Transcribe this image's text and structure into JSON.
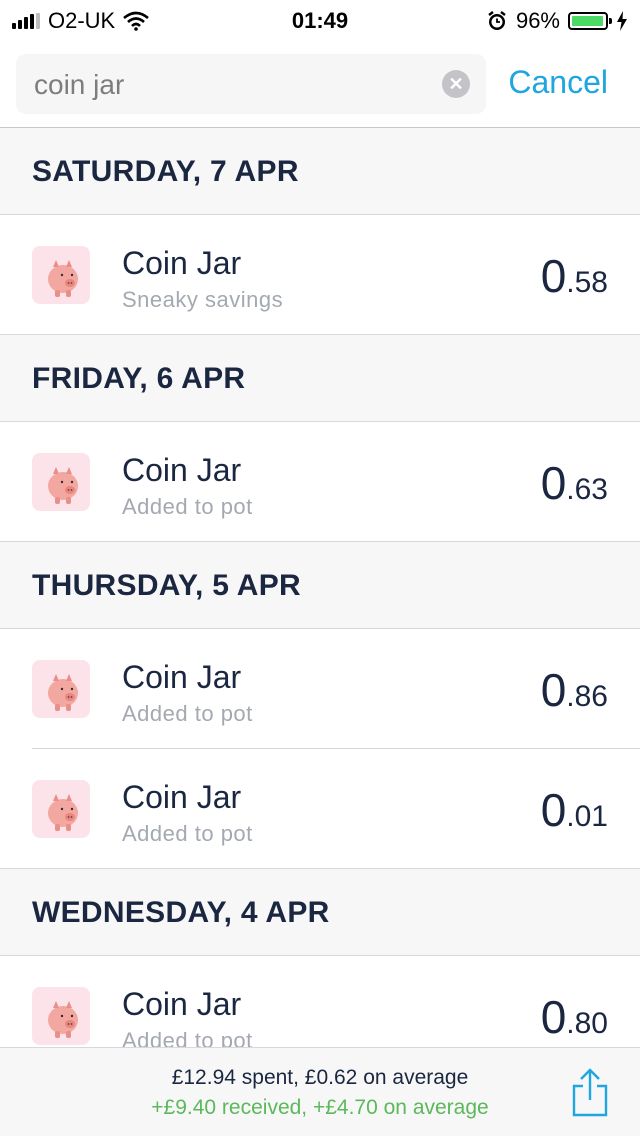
{
  "status_bar": {
    "carrier": "O2-UK",
    "time": "01:49",
    "battery": "96%",
    "battery_level": 0.96
  },
  "search": {
    "value": "coin jar",
    "cancel_label": "Cancel"
  },
  "sections": [
    {
      "header": "SATURDAY, 7 APR",
      "rows": [
        {
          "title": "Coin Jar",
          "subtitle": "Sneaky savings",
          "amount_int": "0",
          "amount_dec": ".58"
        }
      ]
    },
    {
      "header": "FRIDAY, 6 APR",
      "rows": [
        {
          "title": "Coin Jar",
          "subtitle": "Added to pot",
          "amount_int": "0",
          "amount_dec": ".63"
        }
      ]
    },
    {
      "header": "THURSDAY, 5 APR",
      "rows": [
        {
          "title": "Coin Jar",
          "subtitle": "Added to pot",
          "amount_int": "0",
          "amount_dec": ".86"
        },
        {
          "title": "Coin Jar",
          "subtitle": "Added to pot",
          "amount_int": "0",
          "amount_dec": ".01"
        }
      ]
    },
    {
      "header": "WEDNESDAY, 4 APR",
      "rows": [
        {
          "title": "Coin Jar",
          "subtitle": "Added to pot",
          "amount_int": "0",
          "amount_dec": ".80"
        }
      ]
    }
  ],
  "footer": {
    "spent": "£12.94 spent, £0.62 on average",
    "received": "+£9.40 received, +£4.70 on average"
  },
  "colors": {
    "accent": "#1fa5e0",
    "positive": "#5cb85c",
    "text": "#1b2740",
    "battery": "#4cd964"
  },
  "icons": [
    "wifi-icon",
    "alarm-icon",
    "charging-icon",
    "clear-icon",
    "piggy-bank-icon",
    "share-icon"
  ]
}
